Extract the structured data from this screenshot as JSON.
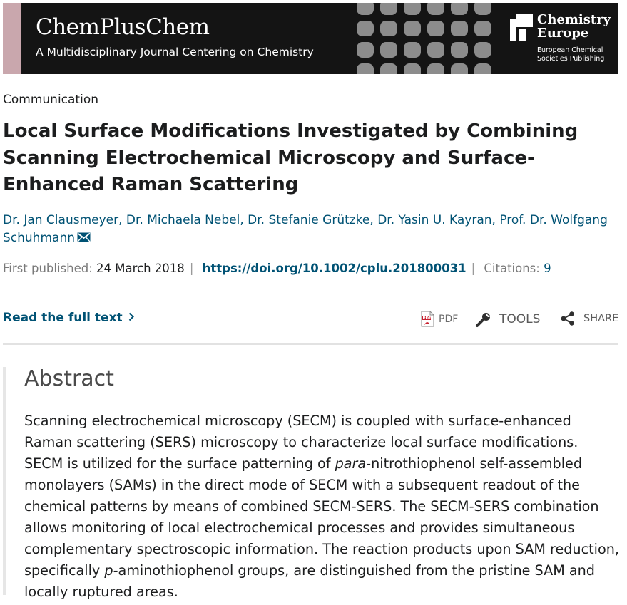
{
  "banner": {
    "journal_name": "ChemPlusChem",
    "tagline": "A Multidisciplinary Journal Centering on Chemistry",
    "publisher_name": "Chemistry Europe",
    "publisher_sub": "European Chemical Societies Publishing",
    "background_color": "#141414",
    "accent_color": "#c9a7ad",
    "dot_color": "#8c8c8c"
  },
  "article": {
    "type": "Communication",
    "title": "Local Surface Modifications Investigated by Combining Scanning Electrochemical Microscopy and Surface-Enhanced Raman Scattering",
    "authors": [
      "Dr. Jan Clausmeyer",
      "Dr. Michaela Nebel",
      "Dr. Stefanie Grützke",
      "Dr. Yasin U. Kayran",
      "Prof. Dr. Wolfgang Schuhmann"
    ],
    "author_separator": ",",
    "corresponding_icon": "envelope-icon",
    "first_published_label": "First published:",
    "first_published_date": "24 March 2018",
    "doi": "https://doi.org/10.1002/cplu.201800031",
    "citations_label": "Citations:",
    "citations_count": "9",
    "link_color": "#005274"
  },
  "actions": {
    "read_full_text": "Read the full text",
    "pdf_label": "PDF",
    "tools_label": "TOOLS",
    "share_label": "SHARE"
  },
  "abstract": {
    "heading": "Abstract",
    "body_1": "Scanning electrochemical microscopy (SECM) is coupled with surface-enhanced Raman scattering (SERS) microscopy to characterize local surface modifications. SECM is utilized for the surface patterning of ",
    "body_italic_1": "para",
    "body_2": "-nitrothiophenol self-assembled monolayers (SAMs) in the direct mode of SECM with a subsequent readout of the chemical patterns by means of combined SECM-SERS. The SECM-SERS combination allows monitoring of local electrochemical processes and provides simultaneous complementary spectroscopic information. The reaction products upon SAM reduction, specifically ",
    "body_italic_2": "p",
    "body_3": "-aminothiophenol groups, are distinguished from the pristine SAM and locally ruptured areas."
  }
}
